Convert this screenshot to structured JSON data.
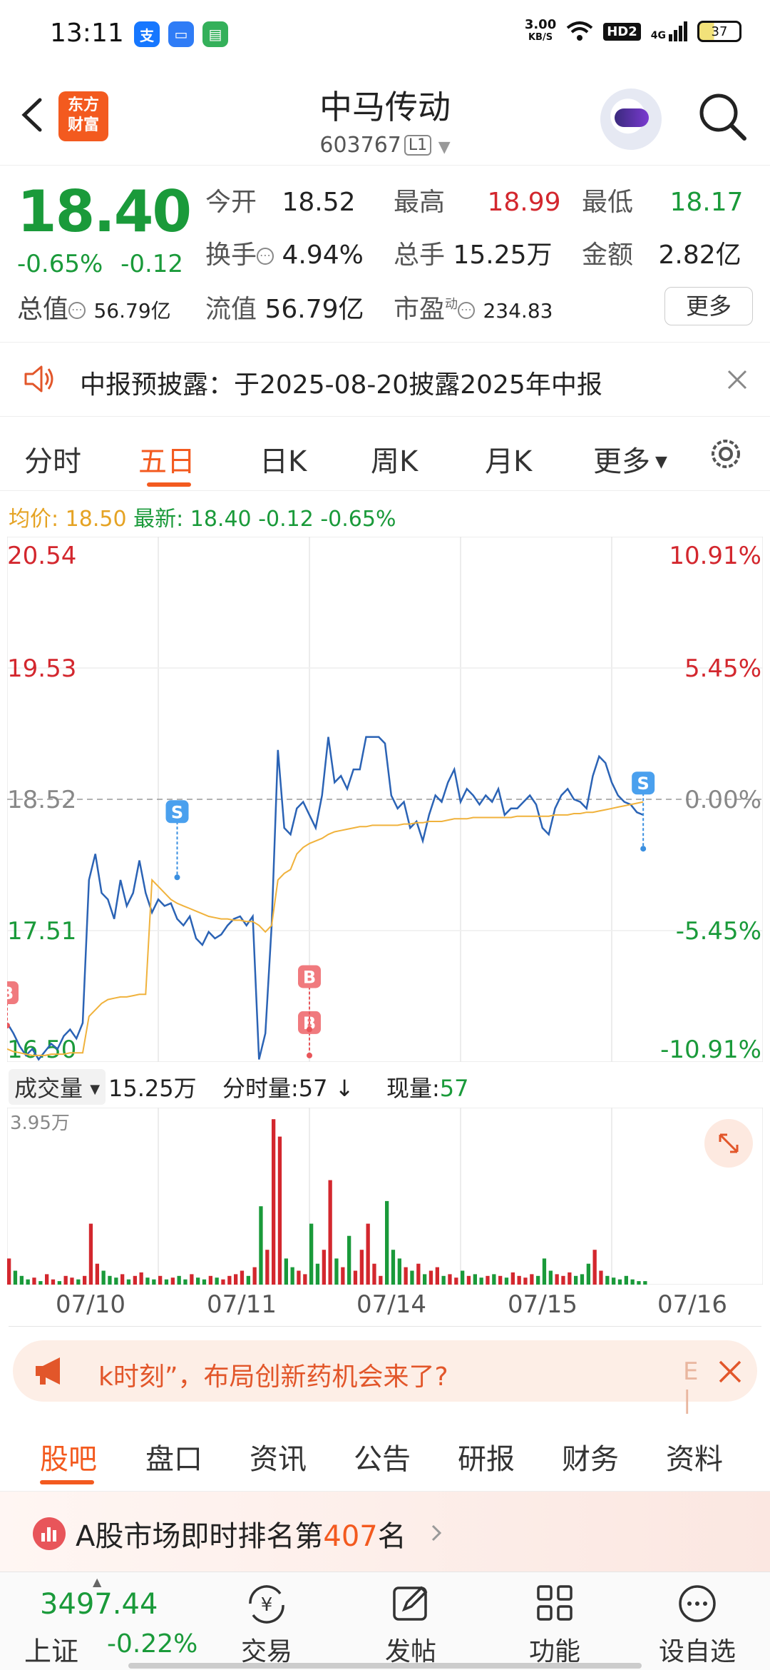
{
  "status_bar": {
    "time": "13:11",
    "net_speed": "3.00",
    "net_unit": "KB/S",
    "hd": "HD2",
    "signal": "4G",
    "battery": "37",
    "app_icons": [
      "alipay-icon",
      "files-icon",
      "messages-icon"
    ]
  },
  "header": {
    "logo_line1": "东方",
    "logo_line2": "财富",
    "stock_name": "中马传动",
    "stock_code": "603767",
    "level_badge": "L1"
  },
  "quote": {
    "price": "18.40",
    "change_pct": "-0.65%",
    "change_amt": "-0.12",
    "total_value_label": "总值",
    "total_value": "56.79亿",
    "row1": {
      "open_label": "今开",
      "open": "18.52",
      "high_label": "最高",
      "high": "18.99",
      "low_label": "最低",
      "low": "18.17"
    },
    "row2": {
      "turnover_label": "换手",
      "turnover": "4.94%",
      "volume_label": "总手",
      "volume": "15.25万",
      "amount_label": "金额",
      "amount": "2.82亿"
    },
    "row3": {
      "float_label": "流值",
      "float_value": "56.79亿",
      "pe_label": "市盈",
      "pe_sup": "动",
      "pe": "234.83"
    },
    "more_button": "更多"
  },
  "notice": {
    "text": "中报预披露：于2025-08-20披露2025年中报"
  },
  "chart_tabs": {
    "items": [
      "分时",
      "五日",
      "日K",
      "周K",
      "月K",
      "更多"
    ],
    "active": "五日"
  },
  "summary": {
    "avg_label": "均价:",
    "avg_value": "18.50",
    "latest_label": "最新:",
    "latest_value": "18.40",
    "latest_chg": "-0.12",
    "latest_pct": "-0.65%"
  },
  "colors": {
    "up": "#d3272e",
    "down": "#1a9a3a",
    "accent": "#f35a1f",
    "price_line": "#2b63b5",
    "avg_line": "#f0b23c"
  },
  "chart_data": {
    "type": "line",
    "title": "",
    "x_labels": [
      "07/10",
      "07/11",
      "07/14",
      "07/15",
      "07/16"
    ],
    "y_left_ticks": [
      "20.54",
      "19.53",
      "18.52",
      "17.51",
      "16.50"
    ],
    "y_right_ticks": [
      "10.91%",
      "5.45%",
      "0.00%",
      "-5.45%",
      "-10.91%"
    ],
    "ylim": [
      16.5,
      20.54
    ],
    "reference_close": 18.52,
    "series": [
      {
        "values": [
          16.8,
          16.72,
          16.62,
          16.55,
          16.6,
          16.52,
          16.58,
          16.64,
          16.6,
          16.7,
          16.75,
          16.68,
          16.8,
          17.9,
          18.1,
          17.8,
          17.75,
          17.6,
          17.9,
          17.7,
          17.8,
          18.05,
          17.8,
          17.65,
          17.75,
          17.7,
          17.72,
          17.6,
          17.55,
          17.62,
          17.45,
          17.4,
          17.5,
          17.45,
          17.48,
          17.55,
          17.6,
          17.62,
          17.55,
          17.62,
          16.52,
          16.72,
          17.55,
          18.9,
          18.3,
          18.25,
          18.45,
          18.5,
          18.4,
          18.3,
          18.55,
          19.0,
          18.65,
          18.7,
          18.6,
          18.75,
          18.75,
          19.0,
          19.0,
          19.0,
          18.95,
          18.55,
          18.45,
          18.5,
          18.3,
          18.35,
          18.2,
          18.4,
          18.55,
          18.5,
          18.65,
          18.75,
          18.5,
          18.6,
          18.55,
          18.48,
          18.55,
          18.5,
          18.6,
          18.4,
          18.45,
          18.45,
          18.5,
          18.55,
          18.48,
          18.3,
          18.25,
          18.45,
          18.55,
          18.6,
          18.52,
          18.5,
          18.45,
          18.7,
          18.85,
          18.8,
          18.65,
          18.55,
          18.5,
          18.48,
          18.42,
          18.4
        ]
      },
      {
        "values": [
          16.6,
          16.58,
          16.57,
          16.56,
          16.55,
          16.55,
          16.55,
          16.56,
          16.56,
          16.56,
          16.57,
          16.57,
          16.57,
          16.85,
          16.9,
          16.95,
          16.98,
          16.99,
          17.0,
          17.0,
          17.01,
          17.02,
          17.02,
          17.9,
          17.85,
          17.8,
          17.75,
          17.72,
          17.7,
          17.68,
          17.66,
          17.64,
          17.62,
          17.61,
          17.6,
          17.6,
          17.59,
          17.59,
          17.58,
          17.58,
          17.55,
          17.5,
          17.55,
          17.9,
          17.95,
          17.98,
          18.1,
          18.15,
          18.18,
          18.2,
          18.22,
          18.25,
          18.27,
          18.28,
          18.29,
          18.3,
          18.31,
          18.31,
          18.32,
          18.32,
          18.32,
          18.32,
          18.32,
          18.33,
          18.33,
          18.34,
          18.34,
          18.35,
          18.35,
          18.35,
          18.36,
          18.37,
          18.37,
          18.37,
          18.38,
          18.38,
          18.38,
          18.38,
          18.38,
          18.38,
          18.38,
          18.39,
          18.39,
          18.39,
          18.39,
          18.39,
          18.39,
          18.4,
          18.4,
          18.4,
          18.41,
          18.41,
          18.42,
          18.42,
          18.43,
          18.44,
          18.45,
          18.46,
          18.47,
          18.48,
          18.49,
          18.5
        ]
      }
    ],
    "markers": [
      {
        "label": "B",
        "day": "07/10"
      },
      {
        "label": "S",
        "day": "07/11"
      },
      {
        "label": "B",
        "day": "07/11"
      },
      {
        "label": "B",
        "day": "07/11"
      },
      {
        "label": "S",
        "day": "07/16"
      }
    ]
  },
  "volume": {
    "selector": "成交量",
    "total": "15.25万",
    "minute_label": "分时量:57",
    "current_label": "现量:",
    "current_value": "57",
    "max_label": "3.95万",
    "bars_note": "",
    "bars": [
      0.15,
      0.08,
      0.05,
      0.03,
      0.04,
      0.02,
      0.06,
      0.03,
      0.02,
      0.05,
      0.04,
      0.03,
      0.05,
      0.35,
      0.12,
      0.08,
      0.05,
      0.04,
      0.06,
      0.03,
      0.05,
      0.07,
      0.04,
      0.03,
      0.05,
      0.03,
      0.04,
      0.05,
      0.03,
      0.06,
      0.04,
      0.03,
      0.05,
      0.04,
      0.03,
      0.05,
      0.06,
      0.08,
      0.05,
      0.1,
      0.45,
      0.2,
      0.95,
      0.85,
      0.15,
      0.1,
      0.08,
      0.06,
      0.35,
      0.12,
      0.2,
      0.6,
      0.15,
      0.1,
      0.28,
      0.08,
      0.2,
      0.35,
      0.12,
      0.05,
      0.48,
      0.2,
      0.15,
      0.1,
      0.08,
      0.12,
      0.06,
      0.08,
      0.1,
      0.05,
      0.06,
      0.04,
      0.08,
      0.05,
      0.06,
      0.04,
      0.05,
      0.06,
      0.05,
      0.04,
      0.07,
      0.05,
      0.04,
      0.06,
      0.05,
      0.15,
      0.08,
      0.06,
      0.05,
      0.07,
      0.05,
      0.06,
      0.12,
      0.2,
      0.08,
      0.05,
      0.04,
      0.03,
      0.05,
      0.03,
      0.02,
      0.02
    ]
  },
  "ad": {
    "text": "k时刻”，布局创新药机会来了?",
    "tail": "E"
  },
  "info_tabs": {
    "items": [
      "股吧",
      "盘口",
      "资讯",
      "公告",
      "研报",
      "财务",
      "资料"
    ],
    "active": "股吧"
  },
  "rank": {
    "prefix": "A股市场即时排名第",
    "number": "407",
    "suffix": "名"
  },
  "bottom_nav": {
    "index_value": "3497.44",
    "index_name": "上证",
    "index_change": "-0.22%",
    "items": [
      "交易",
      "发帖",
      "功能",
      "设自选"
    ]
  }
}
